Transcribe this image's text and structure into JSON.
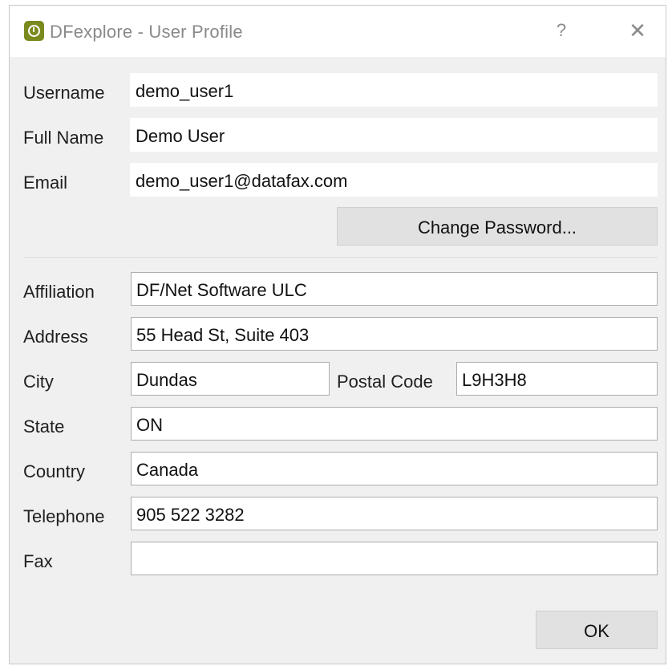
{
  "window": {
    "title": "DFexplore - User Profile",
    "help_label": "?",
    "close_label": "✕",
    "accent_color": "#7a8a1e"
  },
  "account": {
    "username_label": "Username",
    "username_value": "demo_user1",
    "fullname_label": "Full Name",
    "fullname_value": "Demo User",
    "email_label": "Email",
    "email_value": "demo_user1@datafax.com",
    "change_password_label": "Change Password..."
  },
  "contact": {
    "affiliation_label": "Affiliation",
    "affiliation_value": "DF/Net Software ULC",
    "address_label": "Address",
    "address_value": "55 Head St, Suite 403",
    "city_label": "City",
    "city_value": "Dundas",
    "postal_label": "Postal Code",
    "postal_value": "L9H3H8",
    "state_label": "State",
    "state_value": "ON",
    "country_label": "Country",
    "country_value": "Canada",
    "telephone_label": "Telephone",
    "telephone_value": "905 522 3282",
    "fax_label": "Fax",
    "fax_value": ""
  },
  "footer": {
    "ok_label": "OK"
  }
}
